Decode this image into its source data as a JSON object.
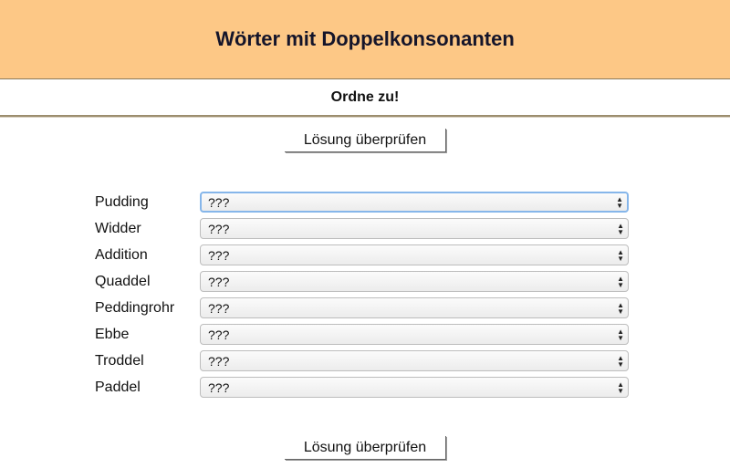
{
  "header": {
    "title": "Wörter mit Doppelkonsonanten"
  },
  "subtitle": "Ordne zu!",
  "buttons": {
    "check_top": "Lösung überprüfen",
    "check_bottom": "Lösung überprüfen"
  },
  "rows": [
    {
      "word": "Pudding",
      "selected": "???",
      "focused": true
    },
    {
      "word": "Widder",
      "selected": "???"
    },
    {
      "word": "Addition",
      "selected": "???"
    },
    {
      "word": "Quaddel",
      "selected": "???"
    },
    {
      "word": "Peddingrohr",
      "selected": "???"
    },
    {
      "word": "Ebbe",
      "selected": "???"
    },
    {
      "word": "Troddel",
      "selected": "???"
    },
    {
      "word": "Paddel",
      "selected": "???"
    }
  ],
  "icons": {
    "select_arrows": "up-down-arrows"
  },
  "colors": {
    "header_bg": "#fdc886",
    "rule": "#9c8d6e",
    "focus": "#86b6ea"
  }
}
